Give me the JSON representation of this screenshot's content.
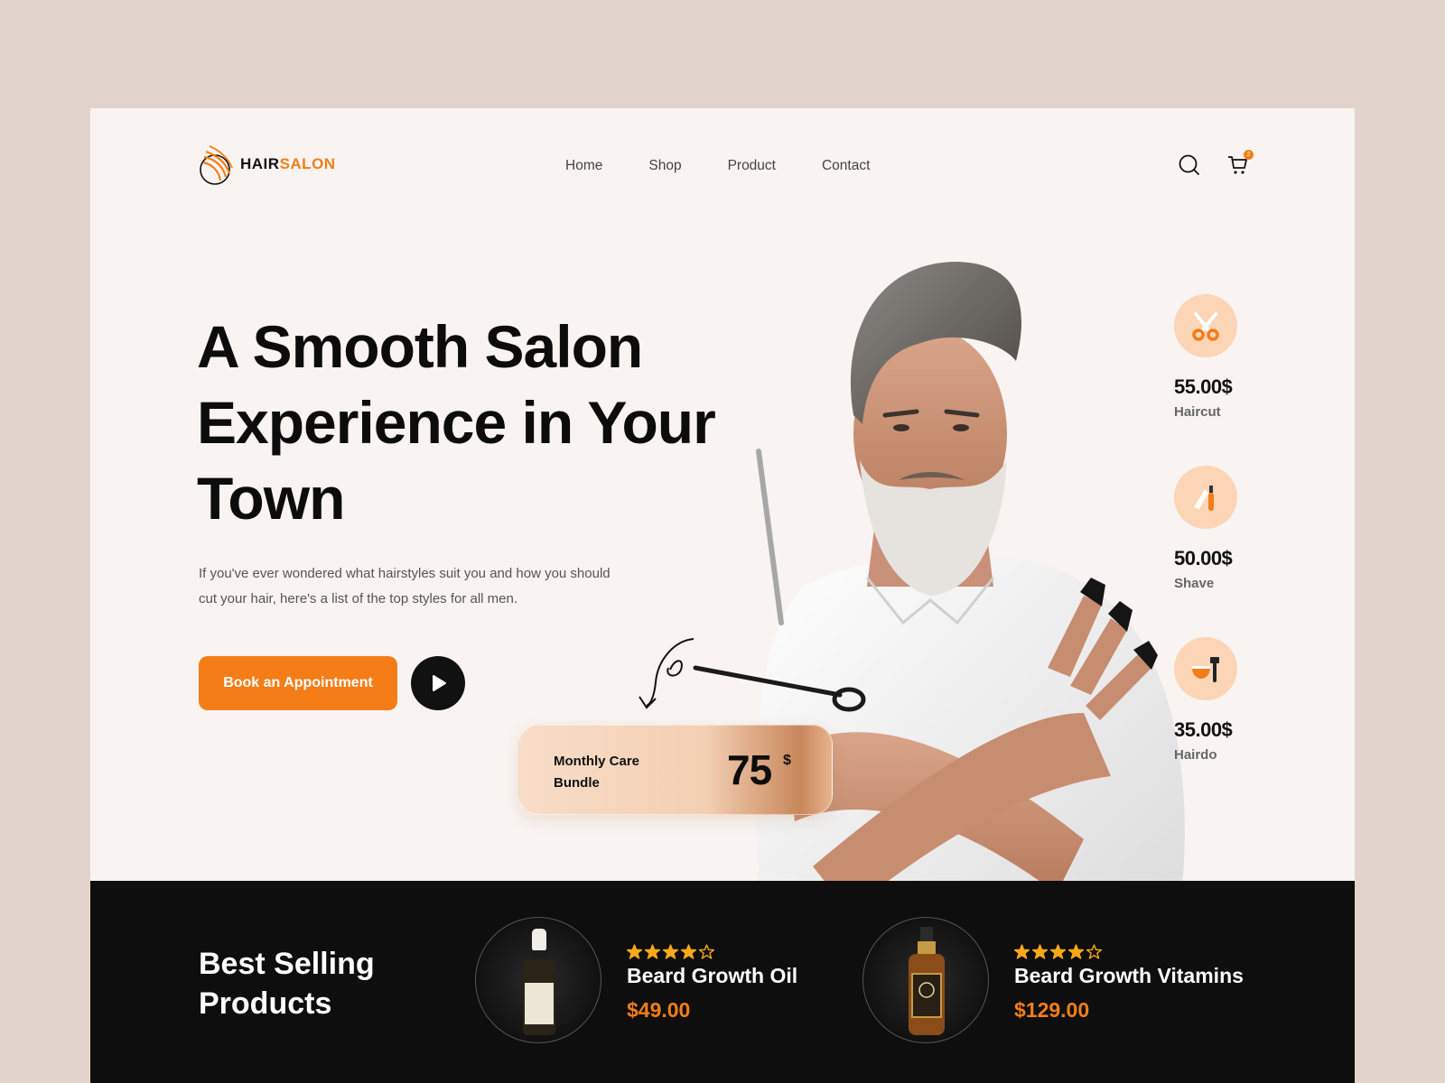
{
  "brand": {
    "name_part1": "HAIR",
    "name_part2": "SALON",
    "accent_color": "#f47d17"
  },
  "nav": {
    "items": [
      "Home",
      "Shop",
      "Product",
      "Contact"
    ]
  },
  "header": {
    "search_icon": "search-icon",
    "cart_icon": "cart-icon",
    "cart_count": "2"
  },
  "hero": {
    "title": "A Smooth Salon Experience in Your Town",
    "description": "If you've ever wondered what hairstyles suit you and how you should cut your hair, here's a list of the top styles for all men.",
    "book_label": "Book an Appointment",
    "play_icon": "play-icon"
  },
  "bundle": {
    "label": "Monthly Care Bundle",
    "price": "75",
    "currency": "$"
  },
  "services": [
    {
      "price": "55.00$",
      "name": "Haircut",
      "icon": "scissors-icon"
    },
    {
      "price": "50.00$",
      "name": "Shave",
      "icon": "razor-icon"
    },
    {
      "price": "35.00$",
      "name": "Hairdo",
      "icon": "brush-bowl-icon"
    }
  ],
  "best_selling": {
    "title": "Best Selling Products",
    "products": [
      {
        "name": "Beard Growth Oil",
        "price": "$49.00",
        "rating": 4,
        "max_rating": 5
      },
      {
        "name": "Beard Growth Vitamins",
        "price": "$129.00",
        "rating": 4,
        "max_rating": 5
      }
    ]
  },
  "colors": {
    "background": "#e2d3cc",
    "page": "#f9f4f2",
    "dark": "#0e0e0e",
    "service_circle": "#fbd5b6"
  }
}
